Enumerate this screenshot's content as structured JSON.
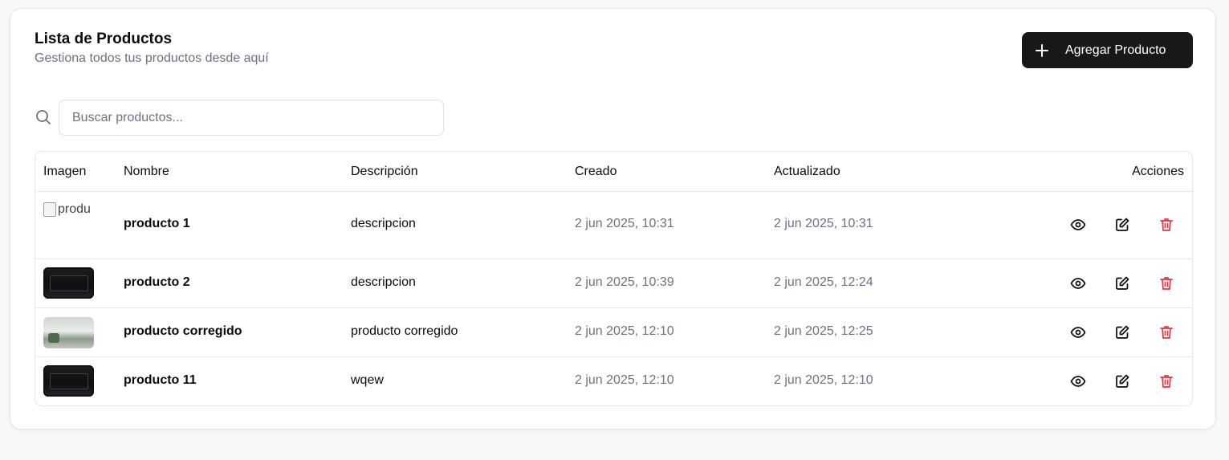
{
  "header": {
    "title": "Lista de Productos",
    "subtitle": "Gestiona todos tus productos desde aquí",
    "add_button_label": "Agregar Producto"
  },
  "search": {
    "placeholder": "Buscar productos...",
    "value": ""
  },
  "table": {
    "columns": {
      "image": "Imagen",
      "name": "Nombre",
      "description": "Descripción",
      "created": "Creado",
      "updated": "Actualizado",
      "actions": "Acciones"
    },
    "rows": [
      {
        "image_alt": "produ",
        "name": "producto 1",
        "description": "descripcion",
        "created": "2 jun 2025, 10:31",
        "updated": "2 jun 2025, 10:31"
      },
      {
        "name": "producto 2",
        "description": "descripcion",
        "created": "2 jun 2025, 10:39",
        "updated": "2 jun 2025, 12:24"
      },
      {
        "name": "producto corregido",
        "description": "producto corregido",
        "created": "2 jun 2025, 12:10",
        "updated": "2 jun 2025, 12:25"
      },
      {
        "name": "producto 11",
        "description": "wqew",
        "created": "2 jun 2025, 12:10",
        "updated": "2 jun 2025, 12:10"
      }
    ]
  },
  "icons": {
    "add": "plus-icon",
    "search": "search-icon",
    "view": "eye-icon",
    "edit": "edit-icon",
    "delete": "trash-icon"
  },
  "colors": {
    "primary_button": "#17181a",
    "delete_icon": "#e5343f",
    "muted_text": "#6b7280"
  }
}
